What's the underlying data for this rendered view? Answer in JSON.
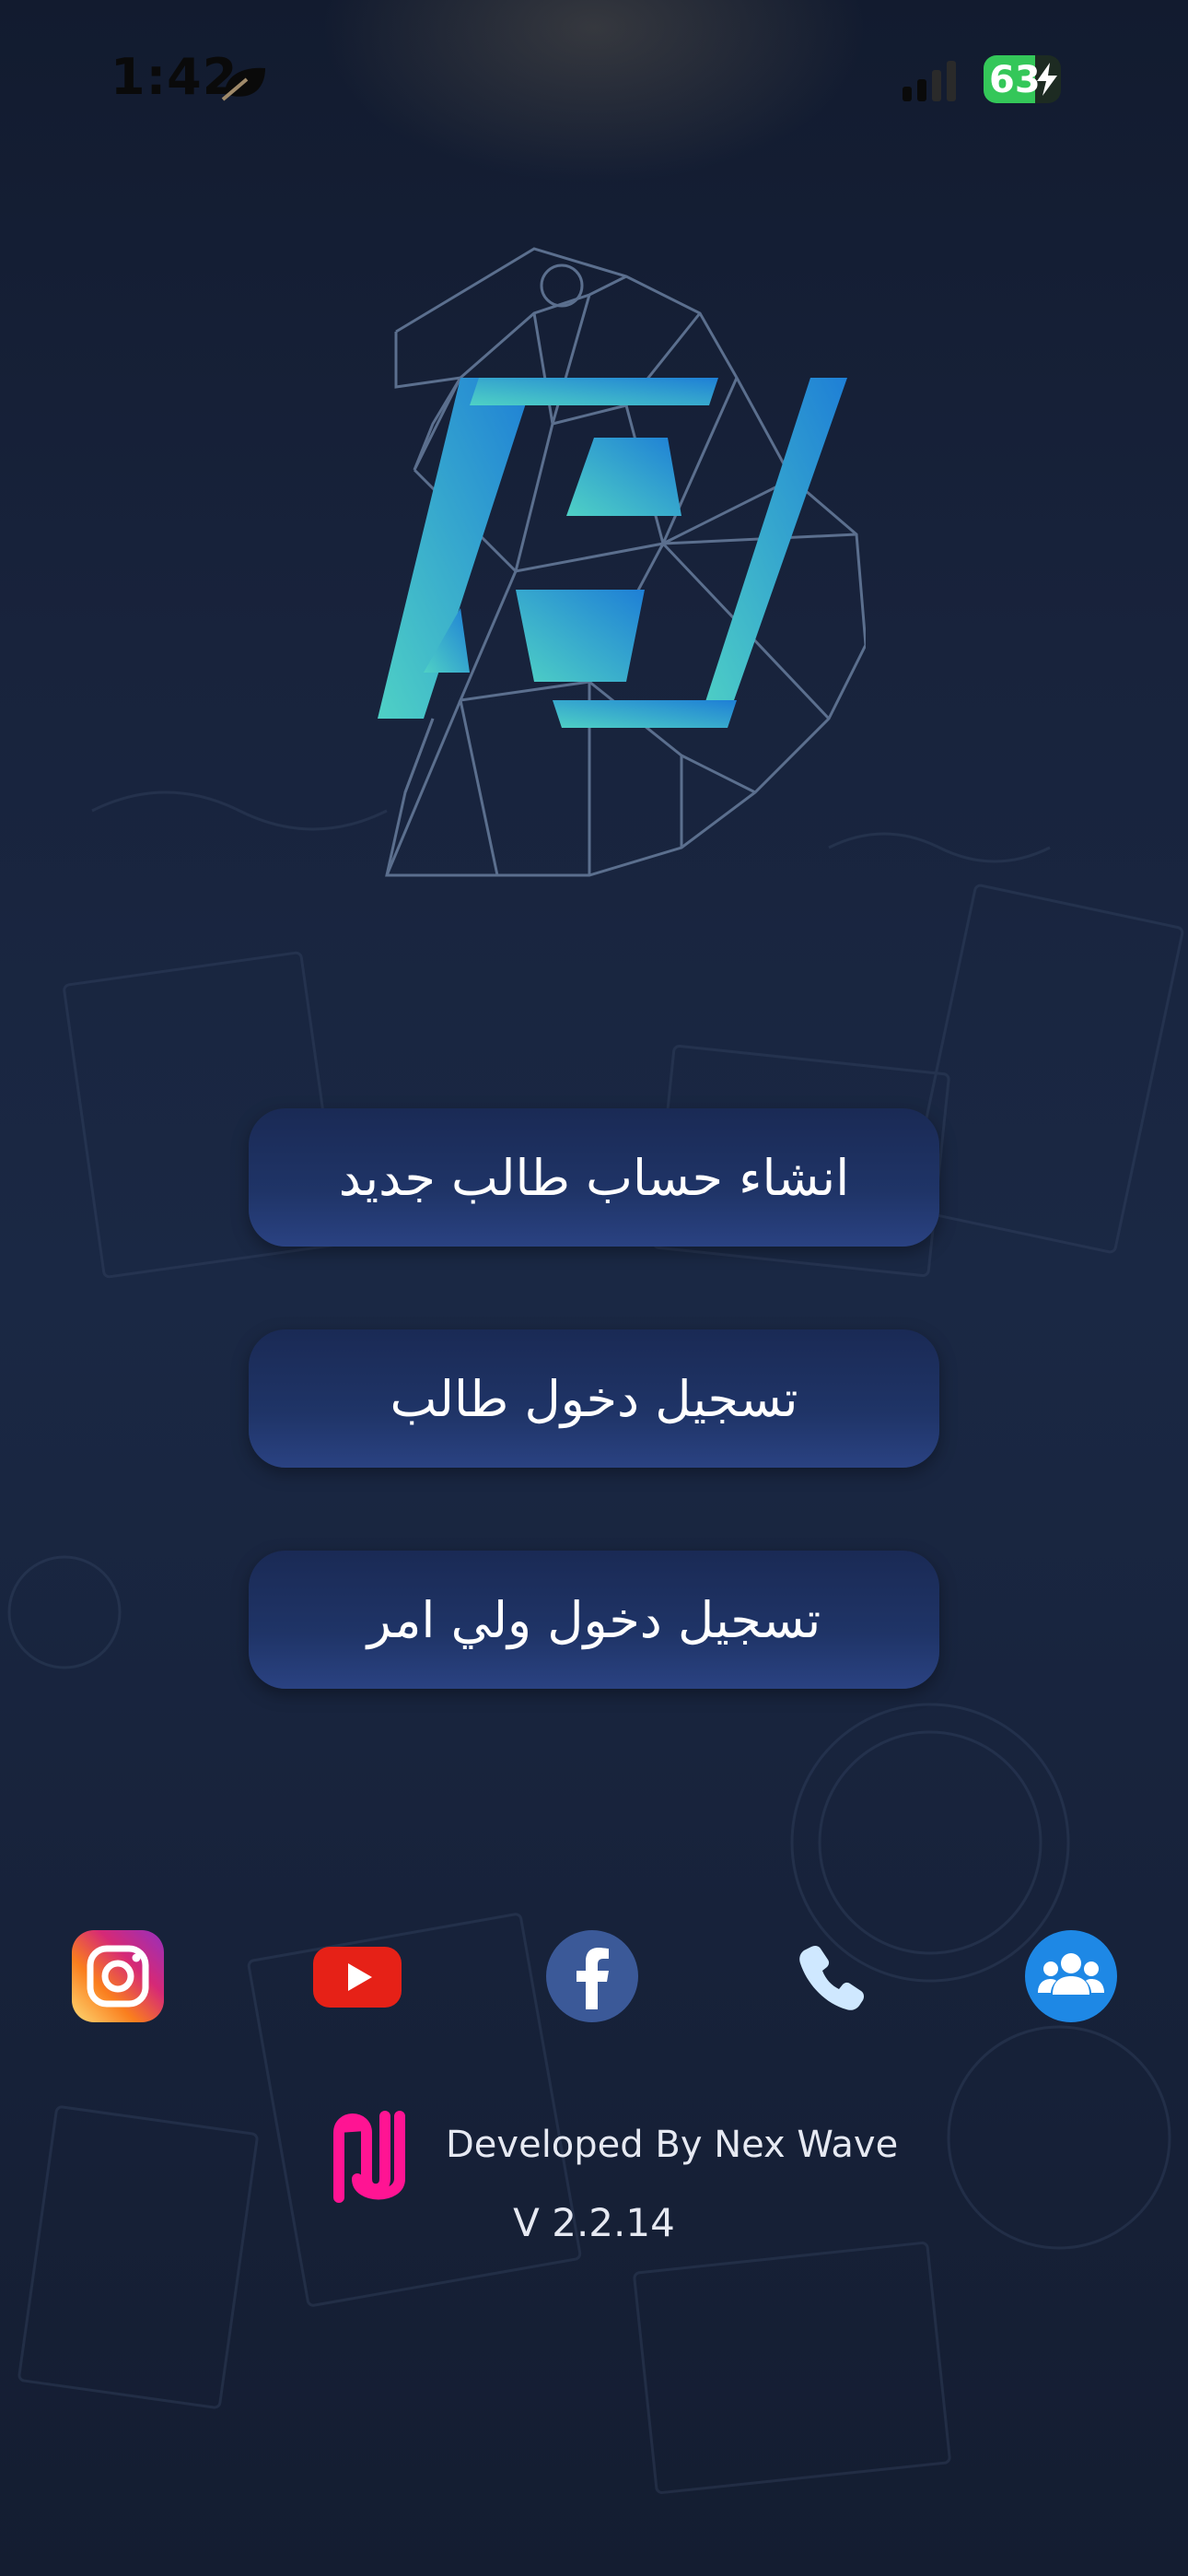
{
  "status_bar": {
    "time": "1:42",
    "battery": "63",
    "mode_icon": "leaf-focus-icon",
    "signal_icon": "cellular-signal-icon",
    "battery_charging_icon": "bolt-icon"
  },
  "logo": {
    "icon": "eagle-logo-icon"
  },
  "buttons": {
    "create_account": "انشاء حساب طالب جديد",
    "student_login": "تسجيل دخول طالب",
    "parent_login": "تسجيل دخول ولي امر"
  },
  "social": [
    {
      "icon": "instagram-icon"
    },
    {
      "icon": "youtube-icon"
    },
    {
      "icon": "facebook-icon"
    },
    {
      "icon": "phone-icon"
    },
    {
      "icon": "group-icon"
    }
  ],
  "footer": {
    "developer": "Developed By Nex Wave",
    "version": "V 2.2.14",
    "developer_logo_icon": "nexwave-logo-icon"
  },
  "colors": {
    "background": "#18233c",
    "button": "#1f3467",
    "logo_accent": "#2fb6d6",
    "battery": "#34c759",
    "dev_logo": "#ff1493"
  }
}
